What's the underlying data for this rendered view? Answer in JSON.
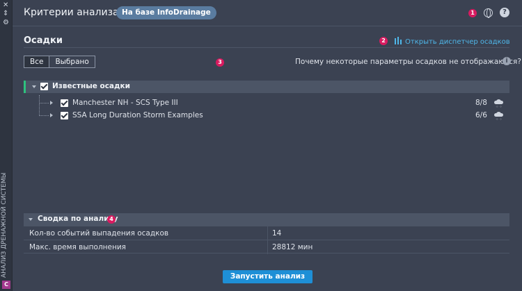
{
  "sidebar": {
    "vertical_title": "АНАЛИЗ ДРЕНАЖНОЙ СИСТЕМЫ",
    "logo_text": "C"
  },
  "header": {
    "title": "Критерии анализа",
    "badge": "На базе InfoDrainage",
    "marker": "1"
  },
  "section": {
    "title": "Осадки",
    "open_manager": "Открыть диспетчер осадков",
    "marker": "2"
  },
  "filter": {
    "tabs": [
      "Все",
      "Выбрано"
    ],
    "marker": "3",
    "why_text": "Почему некоторые параметры осадков не отображаются?"
  },
  "tree": {
    "group_label": "Известные осадки",
    "items": [
      {
        "label": "Manchester NH - SCS Type III",
        "count": "8/8"
      },
      {
        "label": "SSA Long Duration Storm Examples",
        "count": "6/6"
      }
    ]
  },
  "summary": {
    "title": "Сводка по анализу",
    "marker": "4",
    "rows": [
      {
        "key": "Кол-во событий выпадения осадков",
        "value": "14"
      },
      {
        "key": "Макс. время выполнения",
        "value": "28812 мин"
      }
    ]
  },
  "actions": {
    "run_label": "Запустить анализ"
  },
  "colors": {
    "accent": "#1e8fd6",
    "marker": "#d81b60",
    "link": "#4fb7e9",
    "group_bar": "#2ec27e"
  },
  "icons": [
    "close-icon",
    "collapse-icon",
    "settings-icon",
    "globe-icon",
    "help-icon",
    "rain-manager-icon",
    "info-icon",
    "rain-cloud-icon"
  ]
}
